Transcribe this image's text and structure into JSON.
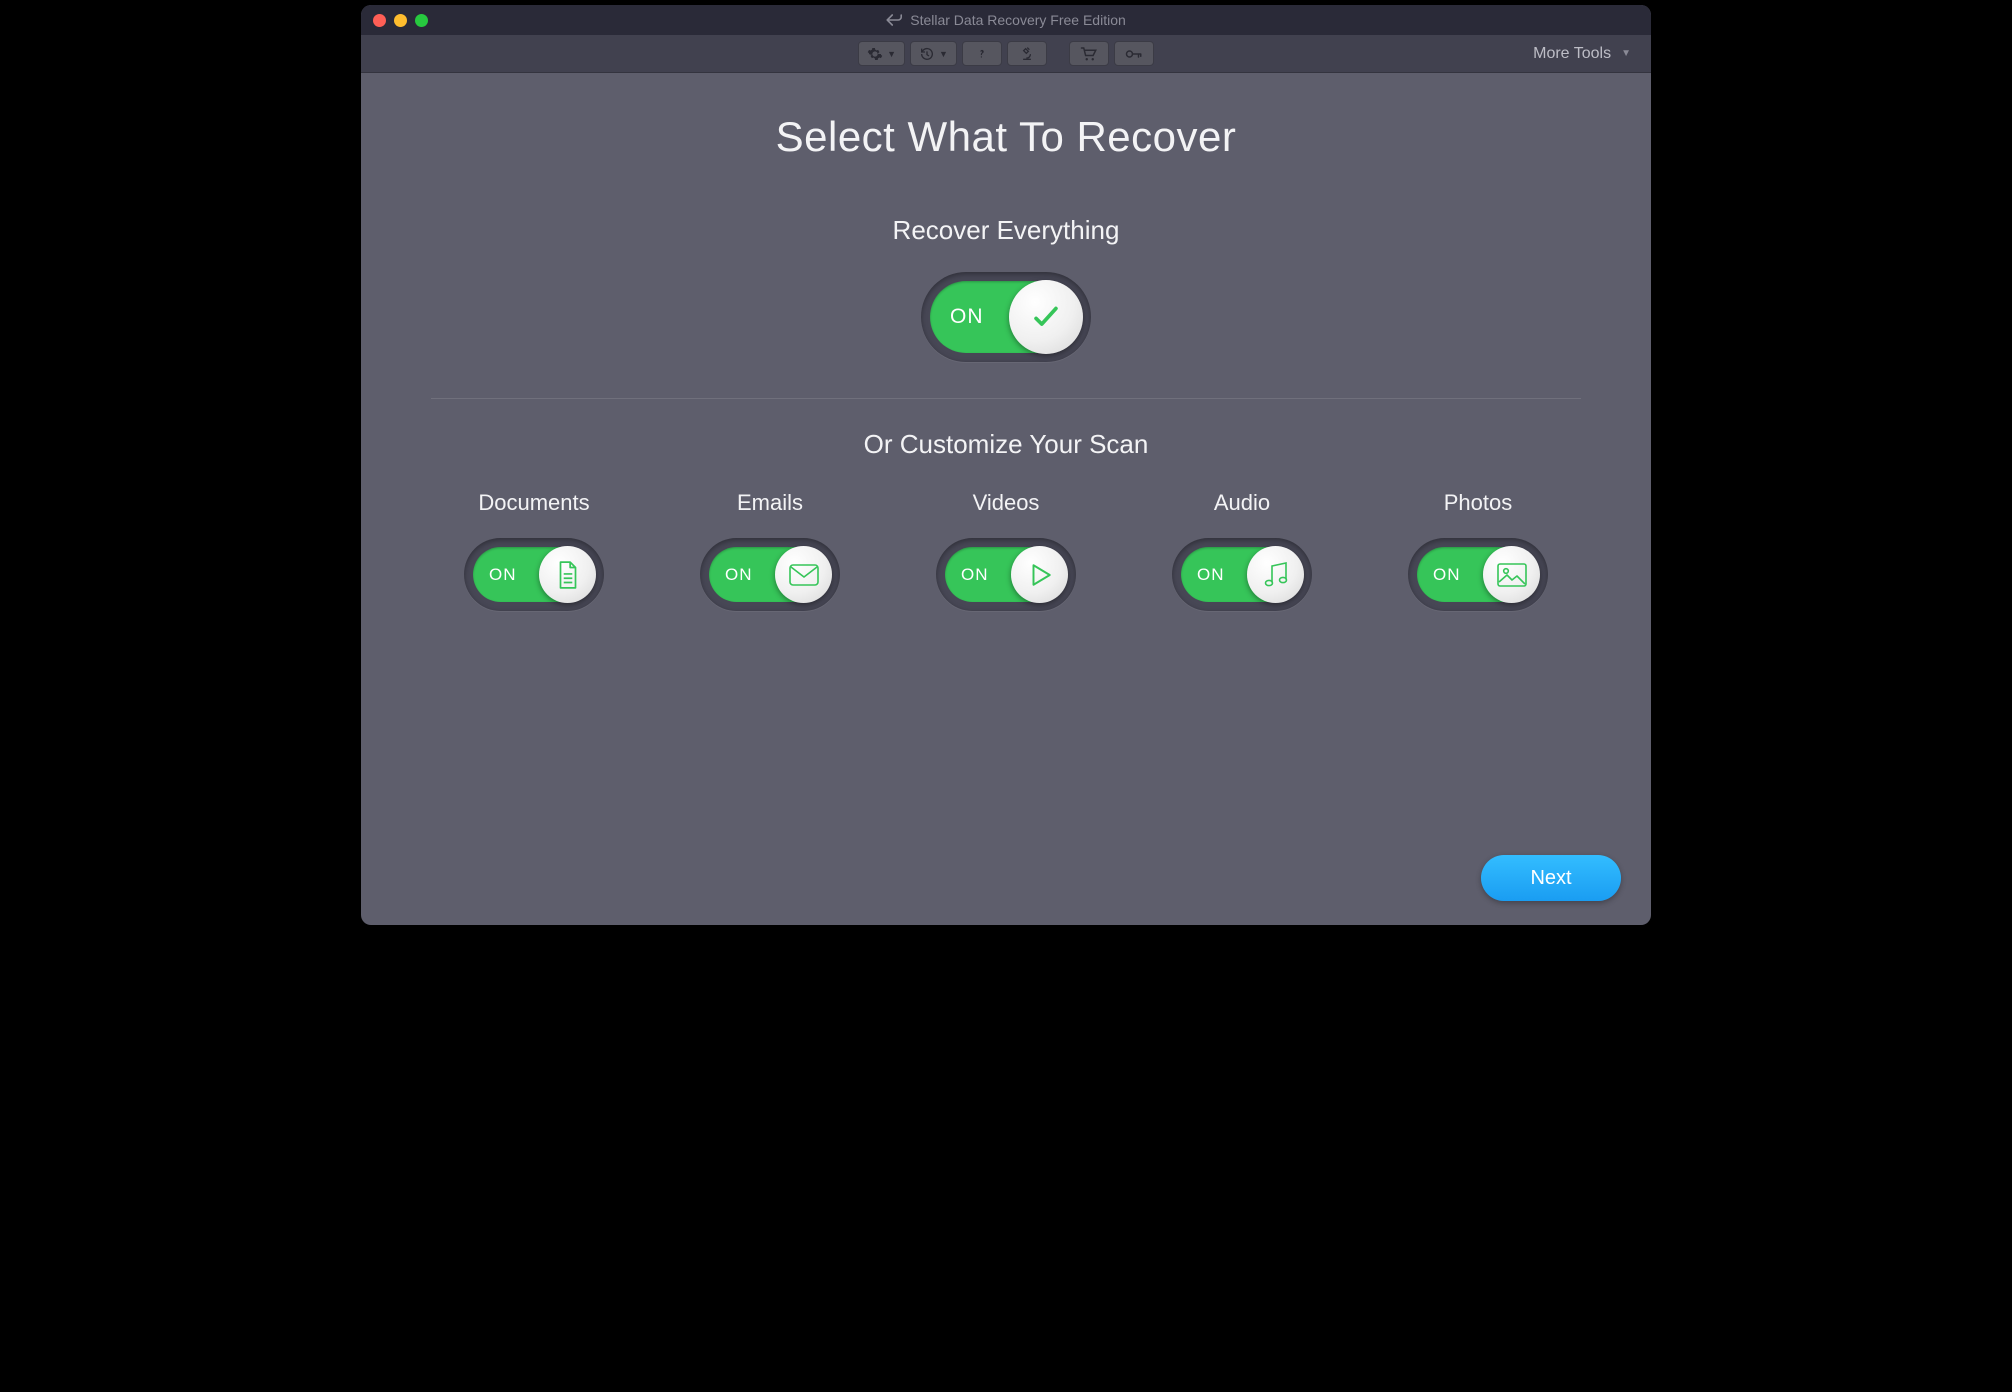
{
  "window": {
    "title": "Stellar Data Recovery Free Edition"
  },
  "toolbar": {
    "more_tools_label": "More Tools"
  },
  "page": {
    "title": "Select What To Recover",
    "recover_everything_label": "Recover Everything",
    "customize_label": "Or Customize Your Scan",
    "toggle_on_label": "ON",
    "next_label": "Next"
  },
  "categories": [
    {
      "label": "Documents",
      "on_label": "ON"
    },
    {
      "label": "Emails",
      "on_label": "ON"
    },
    {
      "label": "Videos",
      "on_label": "ON"
    },
    {
      "label": "Audio",
      "on_label": "ON"
    },
    {
      "label": "Photos",
      "on_label": "ON"
    }
  ],
  "colors": {
    "accent_green": "#36c559",
    "accent_blue": "#1fa7f5",
    "bg_body": "#5e5e6c",
    "bg_titlebar": "#2a2a38",
    "bg_toolbar": "#41414f"
  }
}
